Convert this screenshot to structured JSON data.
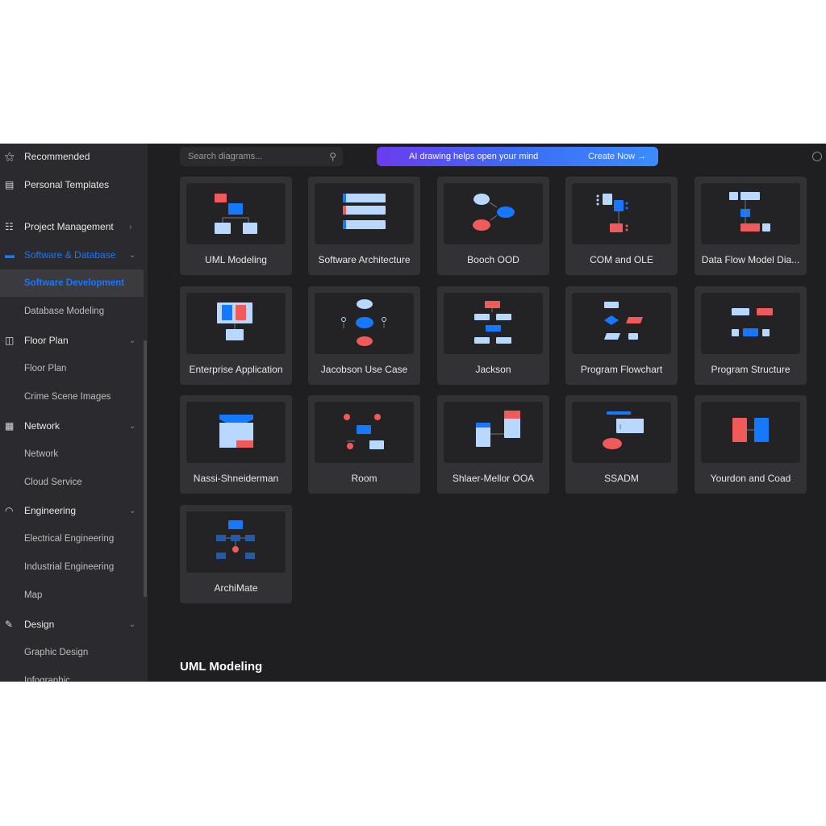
{
  "header": {
    "search_placeholder": "Search diagrams...",
    "banner_text": "AI drawing helps open your mind",
    "banner_button": "Create Now →"
  },
  "sidebar": {
    "items": [
      {
        "label": "Recommended",
        "icon": "badge-icon"
      },
      {
        "label": "Personal Templates",
        "icon": "template-icon"
      },
      {
        "label": "Project Management",
        "icon": "gantt-icon"
      },
      {
        "label": "Software & Database",
        "icon": "window-icon"
      },
      {
        "label": "Software Development"
      },
      {
        "label": "Database Modeling"
      },
      {
        "label": "Floor Plan",
        "icon": "floorplan-icon"
      },
      {
        "label": "Floor Plan"
      },
      {
        "label": "Crime Scene Images"
      },
      {
        "label": "Network",
        "icon": "calendar-icon"
      },
      {
        "label": "Network"
      },
      {
        "label": "Cloud Service"
      },
      {
        "label": "Engineering",
        "icon": "helmet-icon"
      },
      {
        "label": "Electrical Engineering"
      },
      {
        "label": "Industrial Engineering"
      },
      {
        "label": "Map"
      },
      {
        "label": "Design",
        "icon": "design-tools-icon"
      },
      {
        "label": "Graphic Design"
      },
      {
        "label": "Infographic"
      }
    ]
  },
  "templates": [
    "UML Modeling",
    "Software Architecture",
    "Booch OOD",
    "COM and OLE",
    "Data Flow Model Dia...",
    "Enterprise Application",
    "Jacobson Use Case",
    "Jackson",
    "Program Flowchart",
    "Program Structure",
    "Nassi-Shneiderman",
    "Room",
    "Shlaer-Mellor OOA",
    "SSADM",
    "Yourdon and Coad",
    "ArchiMate"
  ],
  "section_title": "UML Modeling",
  "colors": {
    "accent": "#1677ff",
    "light": "#b8d8ff",
    "red": "#f05a5a"
  }
}
